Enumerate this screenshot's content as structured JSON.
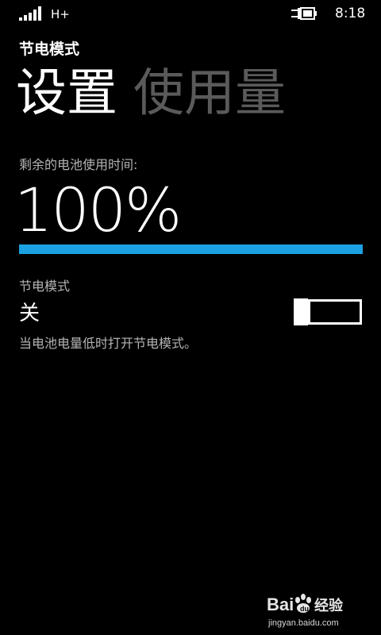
{
  "status_bar": {
    "network_type": "H+",
    "clock": "8:18",
    "signal_icon": "signal-strength-icon",
    "battery_icon": "battery-charging-icon"
  },
  "header": {
    "app_title": "节电模式",
    "tabs": [
      {
        "label": "设置",
        "active": true
      },
      {
        "label": "使用量",
        "active": false
      }
    ]
  },
  "battery": {
    "remaining_label": "剩余的电池使用时间:",
    "percentage_text": "100%",
    "level_percent": 100,
    "accent_color": "#1ba1e2"
  },
  "saver": {
    "label": "节电模式",
    "state": "关",
    "toggle_on": false,
    "description": "当电池电量低时打开节电模式。"
  },
  "watermark": {
    "logo_text": "Bai",
    "logo_suffix": "经验",
    "url": "jingyan.baidu.com"
  }
}
